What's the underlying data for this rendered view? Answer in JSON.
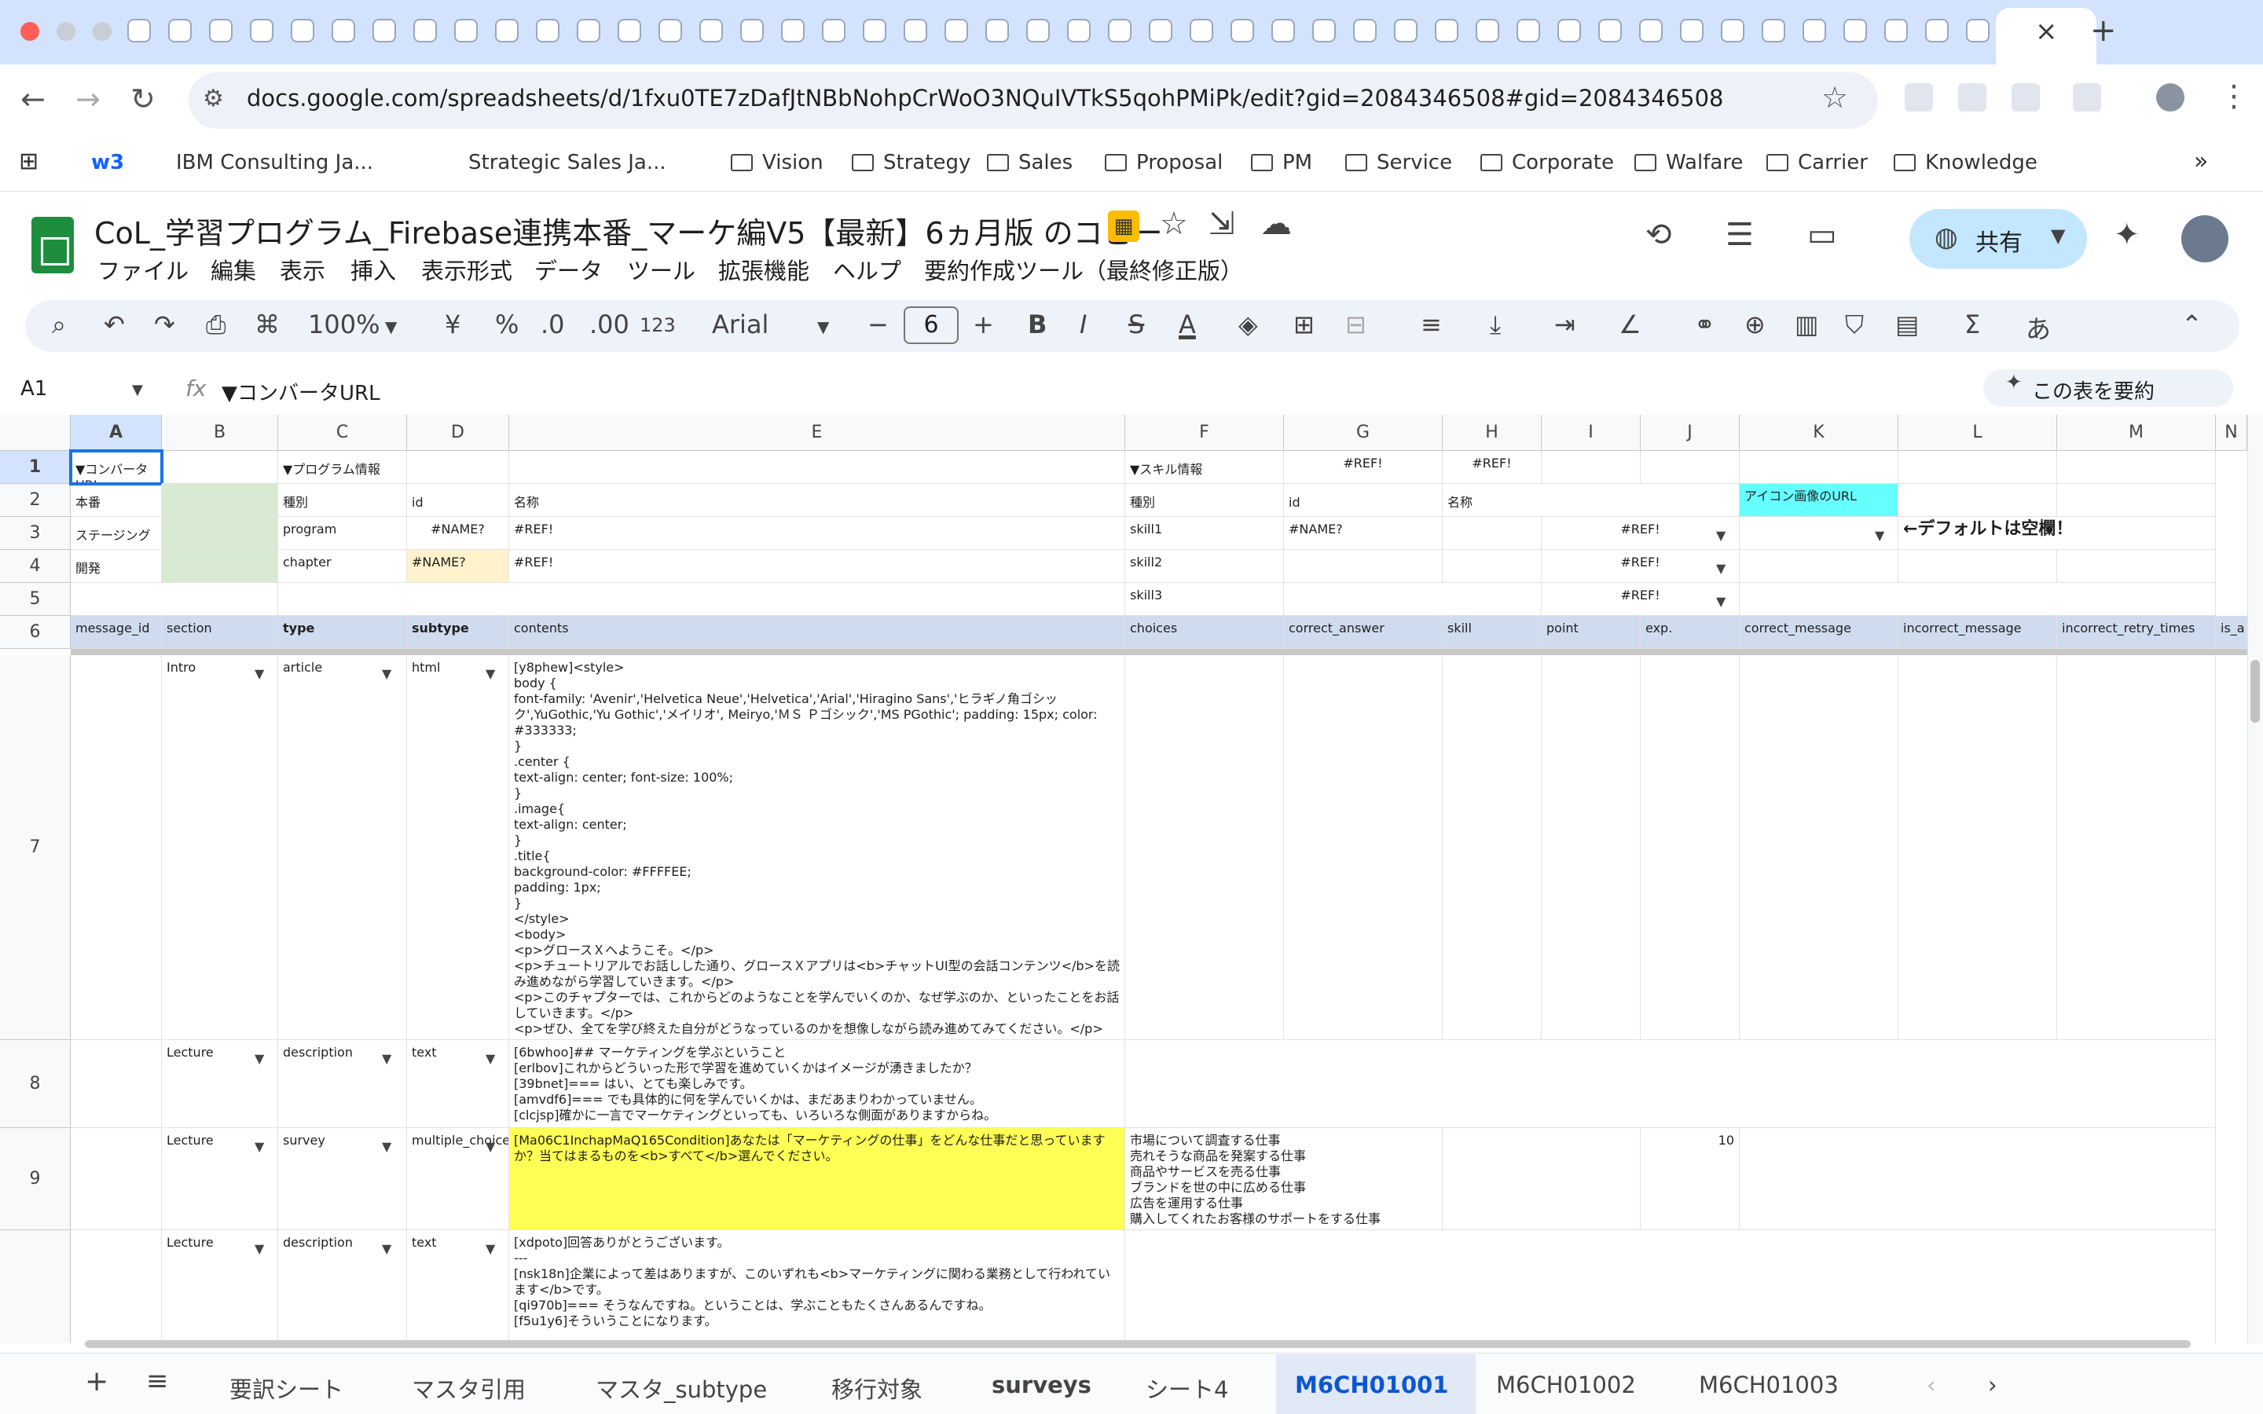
{
  "browser": {
    "url": "docs.google.com/spreadsheets/d/1fxu0TE7zDafJtNBbNohpCrWoO3NQuIVTkS5qohPMiPk/edit?gid=2084346508#gid=2084346508",
    "tab_close": "×",
    "new_tab": "+",
    "bookmarks": [
      "w3",
      "IBM Consulting Ja...",
      "Strategic Sales Ja...",
      "Vision",
      "Strategy",
      "Sales",
      "Proposal",
      "PM",
      "Service",
      "Corporate",
      "Walfare",
      "Carrier",
      "Knowledge"
    ],
    "bookmarks_more": "»"
  },
  "doc": {
    "title": "CoL_学習プログラム_Firebase連携本番_マーケ編V5【最新】6ヵ月版 のコピー",
    "menus": [
      "ファイル",
      "編集",
      "表示",
      "挿入",
      "表示形式",
      "データ",
      "ツール",
      "拡張機能",
      "ヘルプ",
      "要約作成ツール（最終修正版）"
    ],
    "share_label": "共有"
  },
  "toolbar": {
    "zoom": "100%",
    "currency": "¥",
    "percent": "%",
    "dec_minus": ".0",
    "dec_plus": ".00",
    "number_format": "123",
    "font": "Arial",
    "font_size": "6",
    "bold": "B",
    "italic": "I",
    "strike": "S",
    "text_color": "A",
    "input_tool": "あ",
    "sum": "Σ"
  },
  "formula_bar": {
    "name_box": "A1",
    "fx": "fx",
    "formula": "▼コンバータURL",
    "summarize": "この表を要約"
  },
  "grid": {
    "columns": [
      "A",
      "B",
      "C",
      "D",
      "E",
      "F",
      "G",
      "H",
      "I",
      "J",
      "K",
      "L",
      "M",
      "N"
    ],
    "rows": [
      "1",
      "2",
      "3",
      "4",
      "5",
      "6",
      "7",
      "8",
      "9",
      ""
    ],
    "r1": {
      "a": "▼コンバータURL",
      "c": "▼プログラム情報",
      "f": "▼スキル情報",
      "g": "#REF!",
      "h": "#REF!"
    },
    "r2": {
      "a": "本番",
      "c": "種別",
      "d": "id",
      "e": "名称",
      "f": "種別",
      "g": "id",
      "h": "名称",
      "k": "アイコン画像のURL"
    },
    "r3": {
      "a": "ステージング",
      "c": "program",
      "d": "#NAME?",
      "e": "#REF!",
      "f": "skill1",
      "g": "#NAME?",
      "i": "#REF!",
      "l": "←デフォルトは空欄！"
    },
    "r4": {
      "a": "開発",
      "c": "chapter",
      "d": "#NAME?",
      "e": "#REF!",
      "f": "skill2",
      "i": "#REF!"
    },
    "r5": {
      "f": "skill3",
      "i": "#REF!"
    },
    "r6": {
      "a": "message_id",
      "b": "section",
      "c": "type",
      "d": "subtype",
      "e": "contents",
      "f": "choices",
      "g": "correct_answer",
      "h": "skill",
      "i": "point",
      "j": "exp.",
      "k": "correct_message",
      "l": "incorrect_message",
      "m": "incorrect_retry_times",
      "n": "is_a"
    },
    "r7": {
      "b": "Intro",
      "c": "article",
      "d": "html",
      "e": "[y8phew]<style>\nbody {\nfont-family: 'Avenir','Helvetica Neue','Helvetica','Arial','Hiragino Sans','ヒラギノ角ゴシック',YuGothic,'Yu Gothic','メイリオ', Meiryo,'ＭＳ Ｐゴシック','MS PGothic'; padding: 15px; color: #333333;\n}\n.center {\ntext-align: center; font-size: 100%;\n}\n.image{\ntext-align: center;\n}\n.title{\nbackground-color: #FFFFEE;\npadding: 1px;\n}\n</style>\n<body>\n<p>グロースＸへようこそ。</p>\n<p>チュートリアルでお話しした通り、グロースＸアプリは<b>チャットUI型の会話コンテンツ</b>を読み進めながら学習していきます。</p>\n<p>このチャプターでは、これからどのようなことを学んでいくのか、なぜ学ぶのか、といったことをお話していきます。</p>\n<p>ぜひ、全てを学び終えた自分がどうなっているのかを想像しながら読み進めてみてください。</p>\n</body>"
    },
    "r8": {
      "b": "Lecture",
      "c": "description",
      "d": "text",
      "e": "[6bwhoo]## マーケティングを学ぶということ\n[erlbov]これからどういった形で学習を進めていくかはイメージが湧きましたか？\n[39bnet]=== はい、とても楽しみです。\n[amvdf6]=== でも具体的に何を学んでいくかは、まだあまりわかっていません。\n[clcjsp]確かに一言でマーケティングといっても、いろいろな側面がありますからね。"
    },
    "r9": {
      "b": "Lecture",
      "c": "survey",
      "d": "multiple_choice",
      "e": "[Ma06C1InchapMaQ165Condition]あなたは「マーケティングの仕事」をどんな仕事だと思っていますか？当てはまるものを<b>すべて</b>選んでください。",
      "f": "市場について調査する仕事\n売れそうな商品を発案する仕事\n商品やサービスを売る仕事\nブランドを世の中に広める仕事\n広告を運用する仕事\n購入してくれたお客様のサポートをする仕事",
      "j": "10"
    },
    "r10": {
      "b": "Lecture",
      "c": "description",
      "d": "text",
      "e": "[xdpoto]回答ありがとうございます。\n---\n[nsk18n]企業によって差はありますが、このいずれも<b>マーケティングに関わる業務として行われています</b>です。\n[qi970b]=== そうなんですね。ということは、学ぶこともたくさんあるんですね。\n[f5u1y6]そういうことになります。"
    }
  },
  "sheet_tabs": {
    "add": "+",
    "list": "≡",
    "tabs": [
      "要訳シート",
      "マスタ引用",
      "マスタ_subtype",
      "移行対象",
      "surveys",
      "シート4",
      "M6CH01001",
      "M6CH01002",
      "M6CH01003"
    ],
    "active": "M6CH01001"
  },
  "colors": {
    "accent": "#0b57d0",
    "green_fill": "#d9ead3",
    "yellow_fill": "#ffff55",
    "cyan_fill": "#66ffff",
    "header_fill": "#cfdcef"
  }
}
